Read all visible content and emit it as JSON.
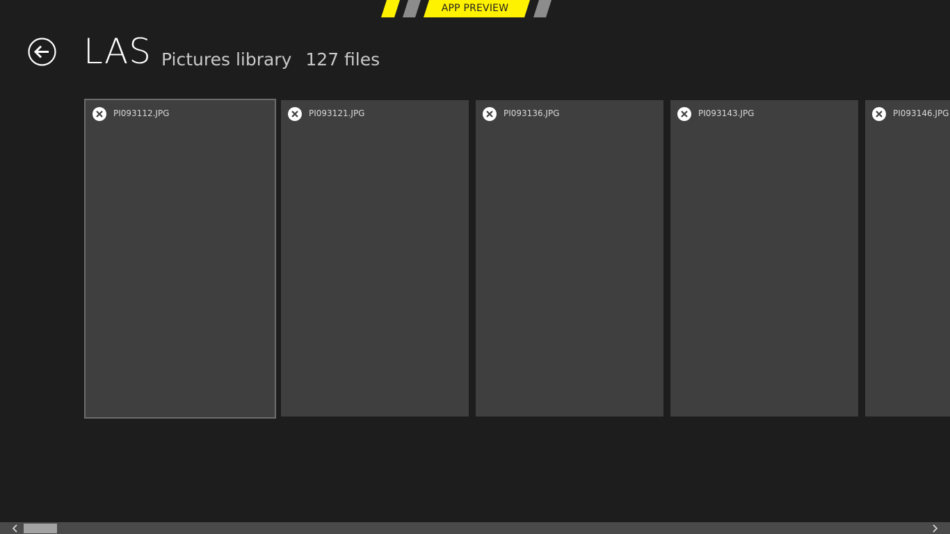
{
  "banner": {
    "label": "APP PREVIEW",
    "accent_color": "#fff200"
  },
  "header": {
    "back_icon": "back-arrow-icon",
    "title": "LAS",
    "library": "Pictures library",
    "file_count": "127 files"
  },
  "files": [
    {
      "name": "PI093112.JPG",
      "selected": true
    },
    {
      "name": "PI093121.JPG",
      "selected": false
    },
    {
      "name": "PI093136.JPG",
      "selected": false
    },
    {
      "name": "PI093143.JPG",
      "selected": false
    },
    {
      "name": "PI093146.JPG",
      "selected": false
    }
  ],
  "scrollbar": {
    "left_icon": "chevron-left-icon",
    "right_icon": "chevron-right-icon"
  }
}
